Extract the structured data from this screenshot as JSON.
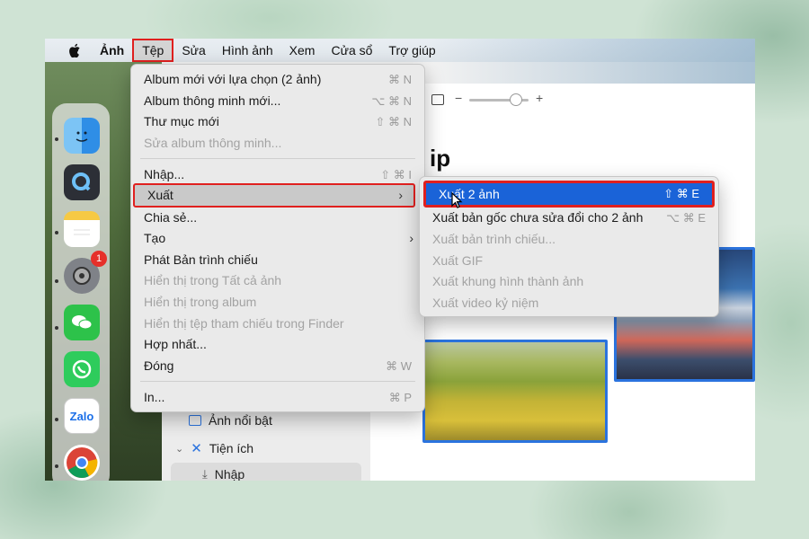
{
  "menubar": {
    "items": [
      "Ảnh",
      "Tệp",
      "Sửa",
      "Hình ảnh",
      "Xem",
      "Cửa sổ",
      "Trợ giúp"
    ]
  },
  "file_menu": {
    "items": [
      {
        "label": "Album mới với lựa chọn (2 ảnh)",
        "shortcut": "⌘ N",
        "disabled": false
      },
      {
        "label": "Album thông minh mới...",
        "shortcut": "⌥ ⌘ N",
        "disabled": false
      },
      {
        "label": "Thư mục mới",
        "shortcut": "⇧ ⌘ N",
        "disabled": false
      },
      {
        "label": "Sửa album thông minh...",
        "shortcut": "",
        "disabled": true
      },
      {
        "label": "Nhập...",
        "shortcut": "⇧ ⌘ I",
        "disabled": false
      },
      {
        "label": "Xuất",
        "shortcut": "",
        "submenu": true,
        "highlighted": true
      },
      {
        "label": "Chia sẻ...",
        "shortcut": "",
        "disabled": false
      },
      {
        "label": "Tạo",
        "shortcut": "",
        "submenu": true
      },
      {
        "label": "Phát Bản trình chiếu",
        "shortcut": "",
        "disabled": false
      },
      {
        "label": "Hiển thị trong Tất cả ảnh",
        "shortcut": "",
        "disabled": true
      },
      {
        "label": "Hiển thị trong album",
        "shortcut": "",
        "disabled": true
      },
      {
        "label": "Hiển thị tệp tham chiếu trong Finder",
        "shortcut": "",
        "disabled": true
      },
      {
        "label": "Hợp nhất...",
        "shortcut": "",
        "disabled": false
      },
      {
        "label": "Đóng",
        "shortcut": "⌘ W",
        "disabled": false
      },
      {
        "label": "In...",
        "shortcut": "⌘ P",
        "disabled": false
      }
    ]
  },
  "export_submenu": {
    "items": [
      {
        "label": "Xuất 2 ảnh",
        "shortcut": "⇧ ⌘ E",
        "highlighted": true
      },
      {
        "label": "Xuất bản gốc chưa sửa đổi cho 2 ảnh",
        "shortcut": "⌥ ⌘ E",
        "disabled": false
      },
      {
        "label": "Xuất bản trình chiếu...",
        "shortcut": "",
        "disabled": true
      },
      {
        "label": "Xuất GIF",
        "shortcut": "",
        "disabled": true
      },
      {
        "label": "Xuất khung hình thành ảnh",
        "shortcut": "",
        "disabled": true
      },
      {
        "label": "Xuất video kỷ niệm",
        "shortcut": "",
        "disabled": true
      }
    ]
  },
  "window": {
    "heading_fragment": "ip",
    "zoom_minus": "−",
    "zoom_plus": "+",
    "sidebar": {
      "featured": "Ảnh nổi bật",
      "utilities": "Tiện ích",
      "import": "Nhập"
    }
  },
  "dock": {
    "items": [
      "finder-icon",
      "quicktime-icon",
      "notes-icon",
      "system-settings-icon",
      "wechat-icon",
      "whatsapp-icon",
      "zalo-icon",
      "chrome-icon"
    ],
    "settings_badge": "1",
    "zalo_label": "Zalo"
  },
  "colors": {
    "highlight_blue": "#1a63d8",
    "annotation_red": "#e0201f"
  }
}
